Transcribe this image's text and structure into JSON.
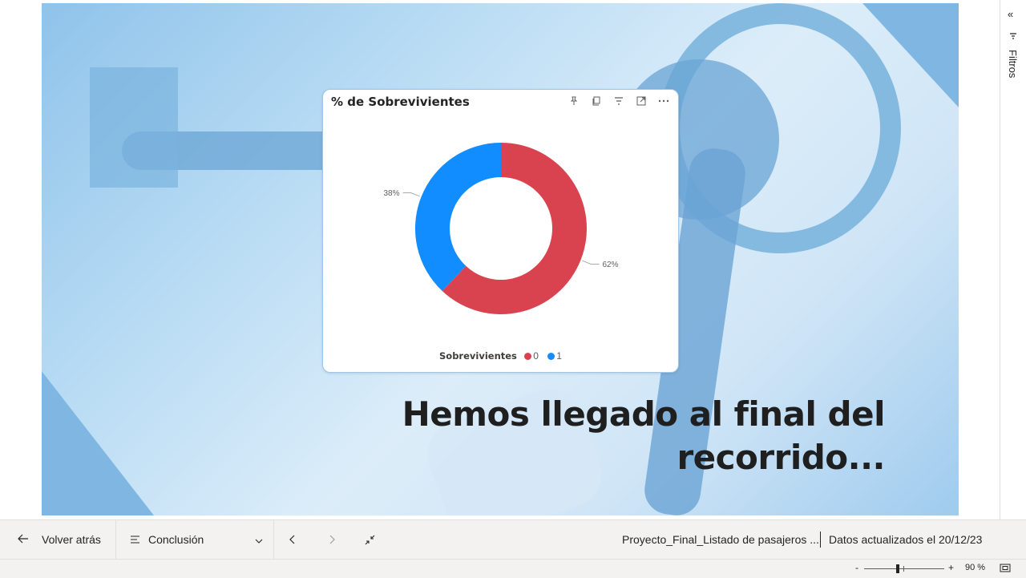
{
  "card": {
    "title": "% de Sobrevivientes",
    "legend_title": "Sobrevivientes"
  },
  "chart_data": {
    "type": "pie",
    "title": "% de Sobrevivientes",
    "legend_title": "Sobrevivientes",
    "legend_placement": "bottom",
    "slices": [
      {
        "label": "0",
        "value": 62,
        "display": "62%",
        "color": "#d9434f"
      },
      {
        "label": "1",
        "value": 38,
        "display": "38%",
        "color": "#118dff"
      }
    ]
  },
  "heading": {
    "line1": "Hemos llegado al final del",
    "line2": "recorrido..."
  },
  "filters": {
    "label": "Filtros"
  },
  "bottom": {
    "back_label": "Volver atrás",
    "page_label": "Conclusión",
    "report_name": "Proyecto_Final_Listado de pasajeros ...",
    "updated": "Datos actualizados el 20/12/23"
  },
  "status": {
    "zoom": "90 %",
    "zoom_level": 0.9
  }
}
